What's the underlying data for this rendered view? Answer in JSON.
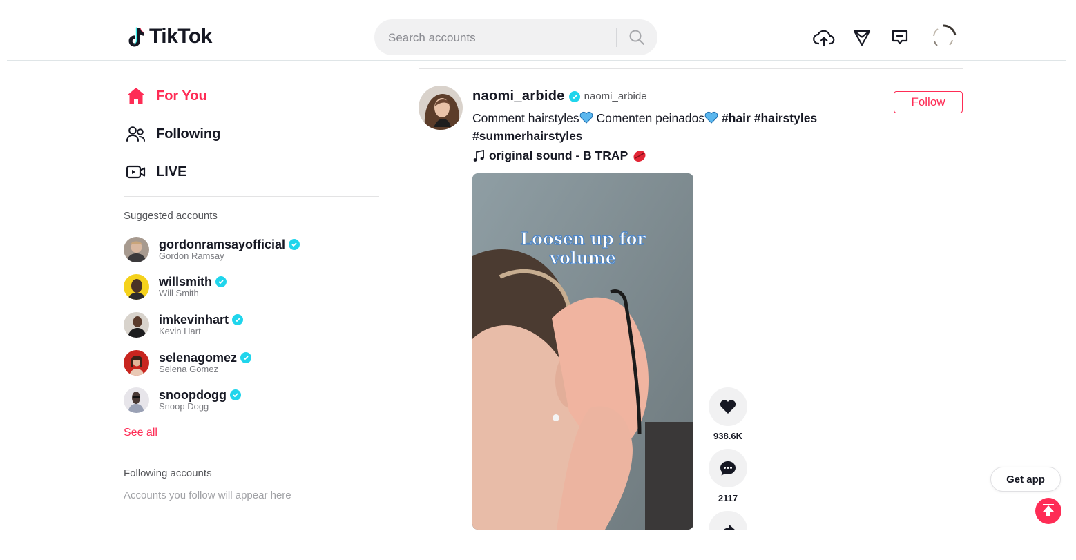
{
  "header": {
    "logo_text": "TikTok",
    "search_placeholder": "Search accounts"
  },
  "sidebar": {
    "nav": [
      {
        "label": "For You",
        "icon": "home-icon",
        "active": true
      },
      {
        "label": "Following",
        "icon": "people-icon",
        "active": false
      },
      {
        "label": "LIVE",
        "icon": "live-icon",
        "active": false
      }
    ],
    "suggested_title": "Suggested accounts",
    "suggested": [
      {
        "username": "gordonramsayofficial",
        "name": "Gordon Ramsay",
        "verified": true
      },
      {
        "username": "willsmith",
        "name": "Will Smith",
        "verified": true
      },
      {
        "username": "imkevinhart",
        "name": "Kevin Hart",
        "verified": true
      },
      {
        "username": "selenagomez",
        "name": "Selena Gomez",
        "verified": true
      },
      {
        "username": "snoopdogg",
        "name": "Snoop Dogg",
        "verified": true
      }
    ],
    "see_all": "See all",
    "following_title": "Following accounts",
    "following_empty": "Accounts you follow will appear here"
  },
  "post": {
    "username": "naomi_arbide",
    "nickname": "naomi_arbide",
    "verified": true,
    "caption_text_1": "Comment hairstyles",
    "caption_text_2": " Comenten peinados",
    "hashtags": [
      "#hair",
      "#hairstyles",
      "#summerhairstyles"
    ],
    "music": "original sound - B TRAP",
    "follow_label": "Follow",
    "video_overlay_line1": "Loosen up for",
    "video_overlay_line2": "volume",
    "likes": "938.6K",
    "comments": "2117"
  },
  "floating": {
    "get_app": "Get app"
  },
  "colors": {
    "brand": "#fe2c55",
    "verified": "#20d5ec",
    "text": "#161823"
  }
}
